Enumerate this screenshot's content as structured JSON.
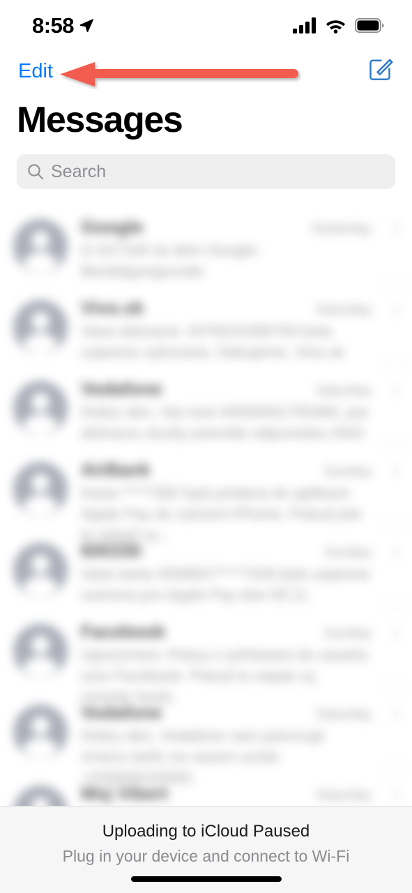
{
  "status_bar": {
    "time": "8:58",
    "location_icon": "location-arrow-icon",
    "cellular_icon": "cellular-signal-icon",
    "cellular_bars": 4,
    "wifi_icon": "wifi-icon",
    "battery_icon": "battery-full-icon",
    "battery_level": 100
  },
  "nav_bar": {
    "edit_label": "Edit",
    "compose_icon": "compose-icon",
    "edit_color": "#007AFF"
  },
  "annotation": {
    "type": "arrow",
    "direction": "left",
    "points_to": "Edit",
    "color": "#F25B4F"
  },
  "header": {
    "title": "Messages"
  },
  "search": {
    "placeholder": "Search",
    "value": "",
    "icon": "search-icon",
    "background": "#EFEFF0"
  },
  "conversations": [
    {
      "title": "Google",
      "time": "Yesterday",
      "preview": "G-527330 ist dein Google-Bestätigungscode.",
      "chevron": "chevron-right-icon"
    },
    {
      "title": "Vivo.sk",
      "time": "Saturday",
      "preview": "Vasa aktivacia: 4378415280793 bola uspesne vykonana. Dakujeme, Vivo.sk",
      "chevron": "chevron-right-icon"
    },
    {
      "title": "Vodafone",
      "time": "Saturday",
      "preview": "Dobry den, Vas kod 44509491705480, pre aktivaciu sluzby potvrdte odpovedou ANO",
      "chevron": "chevron-right-icon"
    },
    {
      "title": "AirBank",
      "time": "Sunday",
      "preview": "Karta ****7382 byla pridana do aplikace Apple Pay do zarizeni iPhone. Pokud jste to nebyli vy...",
      "chevron": "chevron-right-icon"
    },
    {
      "title": "600330",
      "time": "Sunday",
      "preview": "Vase karta 4558657****7328 byla uspesne overena pro Apple Pay dne 09.11.",
      "chevron": "chevron-right-icon"
    },
    {
      "title": "Facebook",
      "time": "Sunday",
      "preview": "Upozorneni: Pokus o prihlaseni do vaseho uctu Facebook. Pokud to nejste vy, zmente heslo.",
      "chevron": "chevron-right-icon"
    },
    {
      "title": "Vodafone",
      "time": "Saturday",
      "preview": "Dobry den, Vodafone vam potvrzuje zmenu tarifu na vasem ucislo +420848193582.",
      "chevron": "chevron-right-icon"
    },
    {
      "title": "Moj Vibert",
      "time": "Saturday",
      "preview": "",
      "chevron": "chevron-right-icon"
    }
  ],
  "banner": {
    "title": "Uploading to iCloud Paused",
    "subtitle": "Plug in your device and connect to Wi-Fi"
  },
  "home_indicator": "home-indicator"
}
